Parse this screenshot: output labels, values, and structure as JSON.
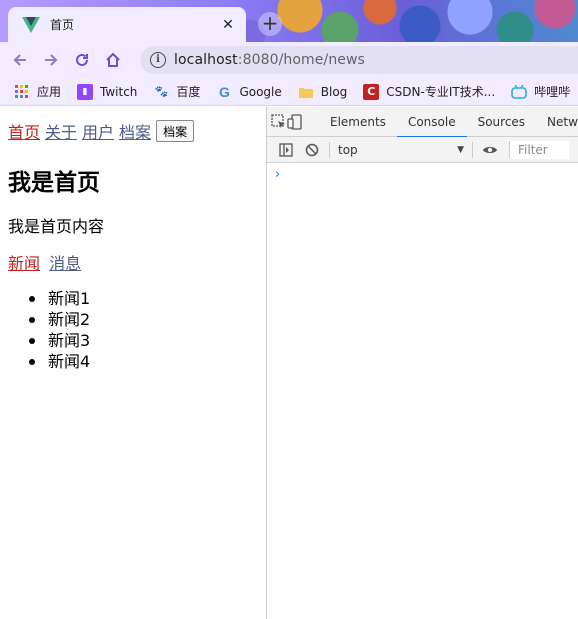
{
  "browser": {
    "tab": {
      "title": "首页",
      "close": "✕"
    },
    "new_tab": "+",
    "url": {
      "host": "localhost",
      "rest": ":8080/home/news"
    },
    "bookmarks": [
      {
        "label": "应用",
        "icon": "apps-grid-icon"
      },
      {
        "label": "Twitch",
        "icon": "twitch-icon"
      },
      {
        "label": "百度",
        "icon": "baidu-icon"
      },
      {
        "label": "Google",
        "icon": "google-icon"
      },
      {
        "label": "Blog",
        "icon": "folder-icon"
      },
      {
        "label": "CSDN-专业IT技术...",
        "icon": "csdn-icon"
      },
      {
        "label": "哔哩哔",
        "icon": "bilibili-icon"
      }
    ]
  },
  "page": {
    "nav": {
      "links": [
        {
          "label": "首页",
          "active": true
        },
        {
          "label": "关于",
          "active": false
        },
        {
          "label": "用户",
          "active": false
        },
        {
          "label": "档案",
          "active": false
        }
      ],
      "button_label": "档案"
    },
    "heading": "我是首页",
    "content": "我是首页内容",
    "subnav": [
      {
        "label": "新闻",
        "active": true
      },
      {
        "label": "消息",
        "active": false
      }
    ],
    "news_items": [
      "新闻1",
      "新闻2",
      "新闻3",
      "新闻4"
    ]
  },
  "devtools": {
    "tabs": [
      {
        "label": "Elements",
        "active": false
      },
      {
        "label": "Console",
        "active": true
      },
      {
        "label": "Sources",
        "active": false
      },
      {
        "label": "Netw",
        "active": false
      }
    ],
    "context": "top",
    "filter_placeholder": "Filter",
    "prompt": "›"
  },
  "colors": {
    "active_link": "#c2211f",
    "link": "#4b5b8a",
    "devtools_accent": "#1a73e8"
  }
}
